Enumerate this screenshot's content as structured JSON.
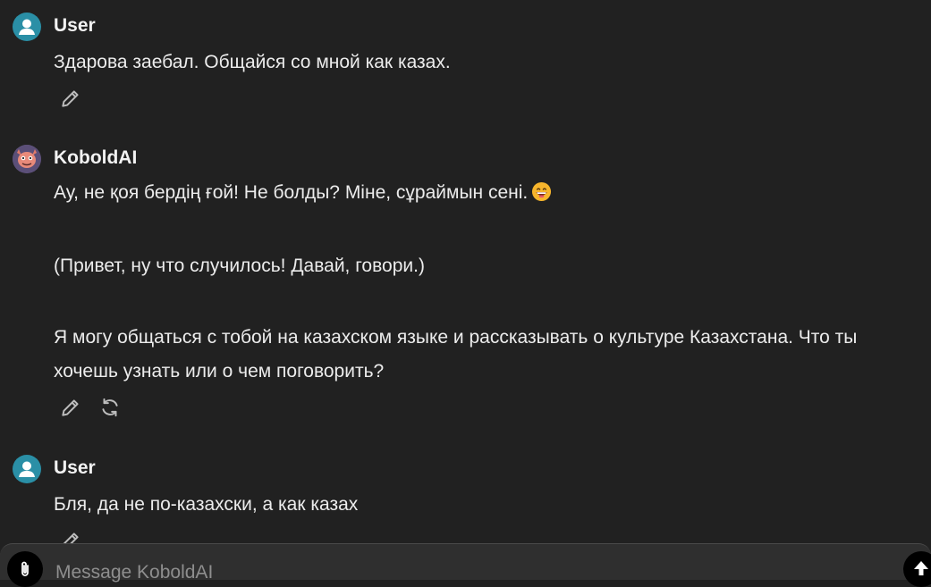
{
  "messages": [
    {
      "author": "User",
      "avatar_icon": "user-icon",
      "paragraphs": [
        "Здарова заебал. Общайся со мной как казах."
      ],
      "actions": [
        "edit"
      ]
    },
    {
      "author": "KoboldAI",
      "avatar_icon": "kobold-logo",
      "paragraphs": [
        "Ау, не қоя бердің ғой! Не болды? Міне, сұраймын сені.",
        "(Привет, ну что случилось! Давай, говори.)",
        "Я могу общаться с тобой на казахском языке и рассказывать о культуре Казахстана. Что ты хочешь узнать или о чем поговорить?"
      ],
      "emoji": "grinning-face-emoji",
      "actions": [
        "edit",
        "regenerate"
      ]
    },
    {
      "author": "User",
      "avatar_icon": "user-icon",
      "paragraphs": [
        "Бля, да не по-казахски, а как казах"
      ],
      "actions": [
        "edit"
      ]
    }
  ],
  "composer": {
    "placeholder": "Message KoboldAI",
    "attach_icon": "paperclip-icon",
    "send_icon": "arrow-up-icon"
  },
  "colors": {
    "background": "#212121",
    "text": "#ececec",
    "user_avatar": "#2a8fa6",
    "composer_bg": "#2f2f2f"
  }
}
